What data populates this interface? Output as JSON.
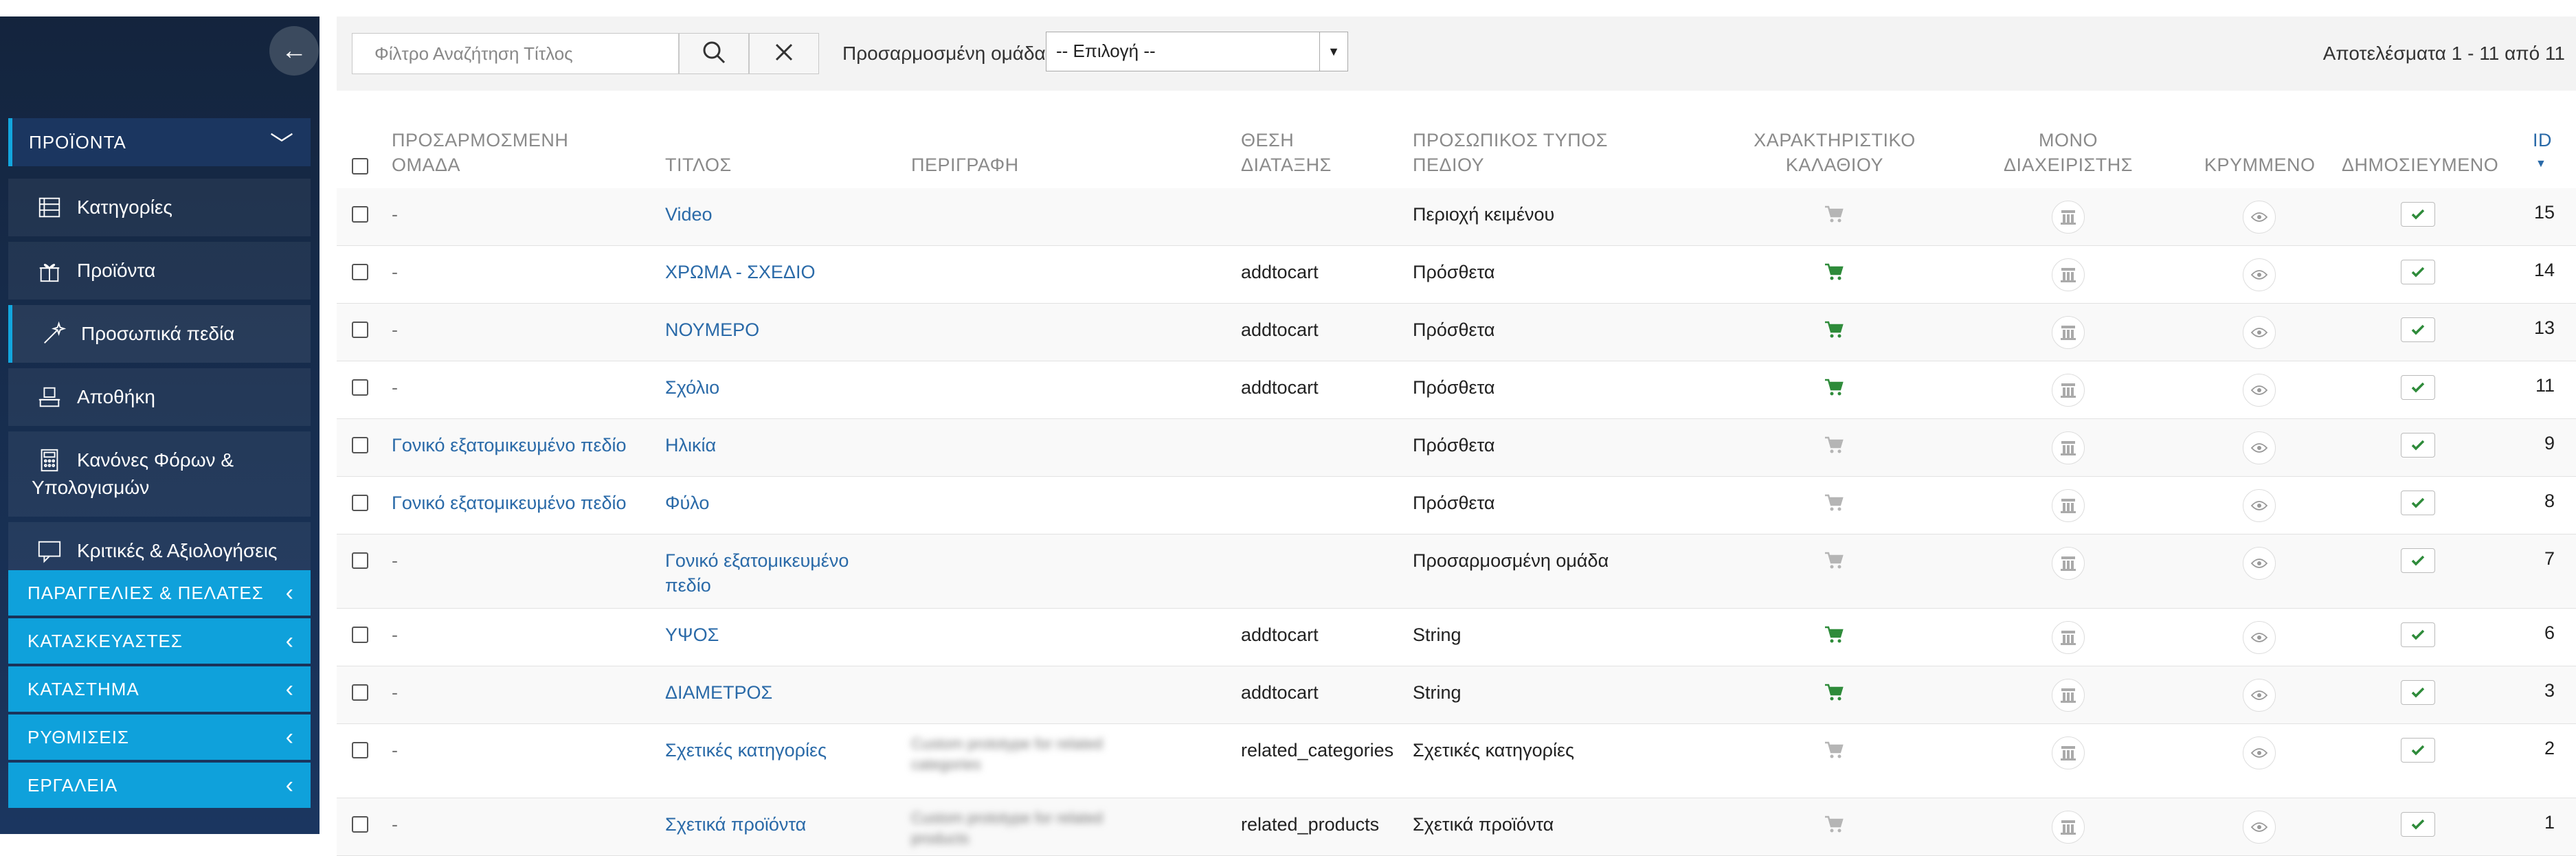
{
  "sidebar": {
    "products_header": "ΠΡΟΪΟΝΤΑ",
    "items": [
      {
        "label": "Κατηγορίες",
        "icon": "list-icon"
      },
      {
        "label": "Προϊόντα",
        "icon": "gift-icon"
      },
      {
        "label": "Προσωπικά πεδία",
        "icon": "magic-wand-icon"
      },
      {
        "label": "Αποθήκη",
        "icon": "warehouse-icon"
      },
      {
        "label": "Κανόνες Φόρων & Υπολογισμών",
        "icon": "calculator-icon"
      },
      {
        "label": "Κριτικές & Αξιολογήσεις",
        "icon": "comment-icon"
      }
    ],
    "categories": [
      "ΠΑΡΑΓΓΕΛΙΕΣ & ΠΕΛΑΤΕΣ",
      "ΚΑΤΑΣΚΕΥΑΣΤΕΣ",
      "ΚΑΤΑΣΤΗΜΑ",
      "ΡΥΘΜΙΣΕΙΣ",
      "ΕΡΓΑΛΕΙΑ"
    ],
    "accent": "#0fa1db"
  },
  "toolbar": {
    "search_placeholder": "Φίλτρο Αναζήτηση Τίτλος",
    "group_label": "Προσαρμοσμένη ομάδα",
    "group_value": "-- Επιλογή --",
    "results": "Αποτελέσματα 1 - 11 από 11"
  },
  "table": {
    "headers": {
      "group": "ΠΡΟΣΑΡΜΟΣΜΕΝΗ ΟΜΑΔΑ",
      "title": "ΤΙΤΛΟΣ",
      "description": "ΠΕΡΙΓΡΑΦΗ",
      "position": "ΘΕΣΗ ΔΙΑΤΑΞΗΣ",
      "type": "ΠΡΟΣΩΠΙΚΟΣ ΤΥΠΟΣ ΠΕΔΙΟΥ",
      "cart": "ΧΑΡΑΚΤΗΡΙΣΤΙΚΟ ΚΑΛΑΘΙΟΥ",
      "admin": "ΜΟΝΟ ΔΙΑΧΕΙΡΙΣΤΗΣ",
      "hidden": "ΚΡΥΜΜΕΝΟ",
      "published": "ΔΗΜΟΣΙΕΥΜΕΝΟ",
      "id": "ID"
    },
    "rows": [
      {
        "group": "-",
        "title": "Video",
        "description": "",
        "position": "",
        "type": "Περιοχή κειμένου",
        "cart": false,
        "id": "15"
      },
      {
        "group": "-",
        "title": "ΧΡΩΜΑ - ΣΧΕΔΙΟ",
        "description": "",
        "position": "addtocart",
        "type": "Πρόσθετα",
        "cart": true,
        "id": "14"
      },
      {
        "group": "-",
        "title": "ΝΟΥΜΕΡΟ",
        "description": "",
        "position": "addtocart",
        "type": "Πρόσθετα",
        "cart": true,
        "id": "13"
      },
      {
        "group": "-",
        "title": "Σχόλιο",
        "description": "",
        "position": "addtocart",
        "type": "Πρόσθετα",
        "cart": true,
        "id": "11"
      },
      {
        "group": "Γονικό εξατομικευμένο πεδίο",
        "title": "Ηλικία",
        "description": "",
        "position": "",
        "type": "Πρόσθετα",
        "cart": false,
        "id": "9"
      },
      {
        "group": "Γονικό εξατομικευμένο πεδίο",
        "title": "Φύλο",
        "description": "",
        "position": "",
        "type": "Πρόσθετα",
        "cart": false,
        "id": "8"
      },
      {
        "group": "-",
        "title": "Γονικό εξατομικευμένο πεδίο",
        "description": "",
        "position": "",
        "type": "Προσαρμοσμένη ομάδα",
        "cart": false,
        "id": "7"
      },
      {
        "group": "-",
        "title": "ΥΨΟΣ",
        "description": "",
        "position": "addtocart",
        "type": "String",
        "cart": true,
        "id": "6"
      },
      {
        "group": "-",
        "title": "ΔΙΑΜΕΤΡΟΣ",
        "description": "",
        "position": "addtocart",
        "type": "String",
        "cart": true,
        "id": "3"
      },
      {
        "group": "-",
        "title": "Σχετικές κατηγορίες",
        "description": "Custom prototype for related categories",
        "position": "related_categories",
        "type": "Σχετικές κατηγορίες",
        "cart": false,
        "id": "2"
      },
      {
        "group": "-",
        "title": "Σχετικά προϊόντα",
        "description": "Custom prototype for related products",
        "position": "related_products",
        "type": "Σχετικά προϊόντα",
        "cart": false,
        "id": "1"
      }
    ],
    "cart_on_color": "#2e8b3a",
    "cart_off_color": "#b5b5b5"
  }
}
